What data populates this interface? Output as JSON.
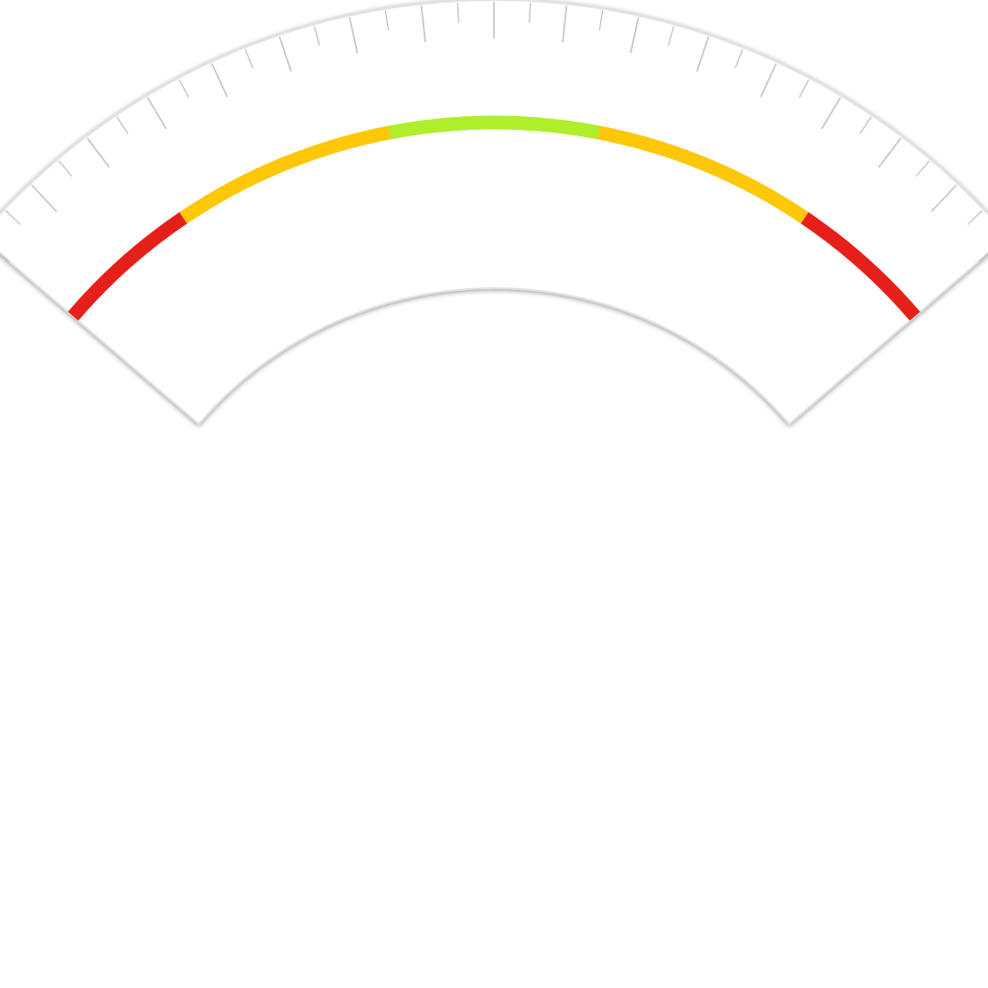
{
  "gauge": {
    "scale": {
      "major_tick_count": 17,
      "minor_per_major": 2,
      "tick_color": "#c2c2c2",
      "bezel_color": "#e2e2e2",
      "face_color": "#ffffff"
    },
    "zones": [
      {
        "name": "low-red",
        "from": 0.0,
        "to": 0.155,
        "color": "#e5201a"
      },
      {
        "name": "low-amber",
        "from": 0.155,
        "to": 0.39,
        "color": "#fec707"
      },
      {
        "name": "green",
        "from": 0.39,
        "to": 0.61,
        "color": "#aeee2a"
      },
      {
        "name": "high-amber",
        "from": 0.61,
        "to": 0.845,
        "color": "#fec707"
      },
      {
        "name": "high-red",
        "from": 0.845,
        "to": 1.0,
        "color": "#e5201a"
      }
    ]
  }
}
